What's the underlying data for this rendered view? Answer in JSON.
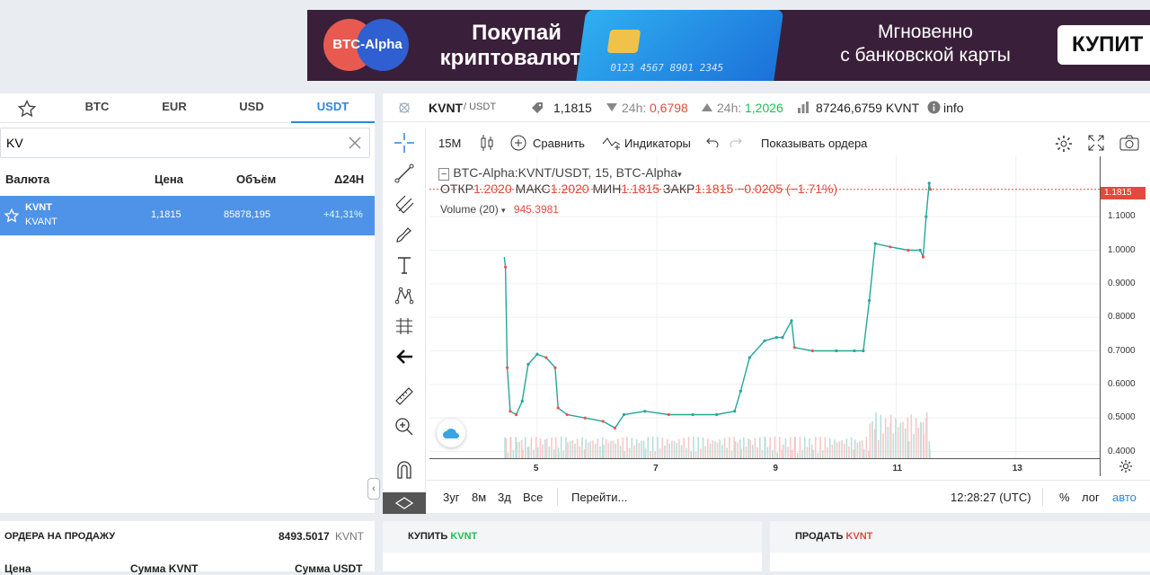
{
  "banner": {
    "logo_text": "BTC-Alpha",
    "left_line1": "Покупай",
    "left_line2": "криптовалюту",
    "card_number": "0123 4567 8901 2345",
    "right_line1": "Мгновенно",
    "right_line2": "с банковской карты",
    "buy_label": "КУПИТ"
  },
  "market": {
    "favorites_icon": "star-icon",
    "tabs": [
      "BTC",
      "EUR",
      "USD",
      "USDT"
    ],
    "active_tab": "USDT",
    "search": {
      "value": "KV",
      "placeholder": ""
    },
    "columns": [
      "Валюта",
      "Цена",
      "Объём",
      "Δ24H"
    ],
    "rows": [
      {
        "symbol": "KVNT",
        "name": "KVANT",
        "price": "1,1815",
        "volume": "85878,195",
        "change": "+41,31%"
      }
    ]
  },
  "ticker": {
    "symbol": "KVNT",
    "quote": "/ USDT",
    "last_price": "1,1815",
    "low_label": "24h:",
    "low_value": "0,6798",
    "high_label": "24h:",
    "high_value": "1,2026",
    "volume": "87246,6759 KVNT",
    "info_label": "info"
  },
  "toolbar": {
    "interval": "15M",
    "compare_label": "Сравнить",
    "indicators_label": "Индикаторы",
    "show_orders_label": "Показывать ордера"
  },
  "chart_legend": {
    "title": "BTC-Alpha:KVNT/USDT, 15, BTC-Alpha",
    "open_label": "ОТКР",
    "open": "1.2020",
    "high_label": "МАКС",
    "high": "1.2020",
    "low_label": "МИН",
    "low": "1.1815",
    "close_label": "ЗАКР",
    "close": "1.1815",
    "change": "−0.0205 (−1.71%)",
    "volume_label": "Volume (20)",
    "volume_value": "945.3981"
  },
  "chart_data": {
    "type": "line",
    "title": "BTC-Alpha:KVNT/USDT, 15, BTC-Alpha",
    "x_ticks": [
      "5",
      "7",
      "9",
      "11",
      "13"
    ],
    "y_ticks": [
      "1.1000",
      "1.0000",
      "0.9000",
      "0.8000",
      "0.7000",
      "0.6000",
      "0.5000",
      "0.4000"
    ],
    "ylim": [
      0.38,
      1.28
    ],
    "xlim": [
      3.2,
      14.4
    ],
    "current_price": "1.1815",
    "series": [
      {
        "values": [
          [
            4.45,
            0.98
          ],
          [
            4.47,
            0.95
          ],
          [
            4.5,
            0.65
          ],
          [
            4.55,
            0.52
          ],
          [
            4.65,
            0.51
          ],
          [
            4.75,
            0.55
          ],
          [
            4.85,
            0.66
          ],
          [
            5.0,
            0.69
          ],
          [
            5.15,
            0.68
          ],
          [
            5.3,
            0.65
          ],
          [
            5.35,
            0.53
          ],
          [
            5.5,
            0.51
          ],
          [
            5.8,
            0.5
          ],
          [
            6.1,
            0.49
          ],
          [
            6.3,
            0.47
          ],
          [
            6.45,
            0.51
          ],
          [
            6.8,
            0.52
          ],
          [
            7.2,
            0.51
          ],
          [
            7.6,
            0.51
          ],
          [
            8.0,
            0.51
          ],
          [
            8.3,
            0.52
          ],
          [
            8.4,
            0.58
          ],
          [
            8.55,
            0.68
          ],
          [
            8.8,
            0.73
          ],
          [
            9.0,
            0.74
          ],
          [
            9.1,
            0.74
          ],
          [
            9.25,
            0.79
          ],
          [
            9.3,
            0.71
          ],
          [
            9.6,
            0.7
          ],
          [
            10.0,
            0.7
          ],
          [
            10.3,
            0.7
          ],
          [
            10.45,
            0.7
          ],
          [
            10.55,
            0.85
          ],
          [
            10.65,
            1.02
          ],
          [
            10.9,
            1.01
          ],
          [
            11.2,
            1.0
          ],
          [
            11.4,
            1.0
          ],
          [
            11.45,
            0.98
          ],
          [
            11.5,
            1.1
          ],
          [
            11.55,
            1.2
          ],
          [
            11.57,
            1.1815
          ]
        ]
      }
    ],
    "grid": true
  },
  "bottom_bar": {
    "ranges": [
      "3уг",
      "8м",
      "3д",
      "Все"
    ],
    "goto_label": "Перейти...",
    "time": "12:28:27 (UTC)",
    "percent_label": "%",
    "log_label": "лог",
    "auto_label": "авто"
  },
  "sell_orders": {
    "title": "ОРДЕРА НА ПРОДАЖУ",
    "total": "8493.5017",
    "total_unit": "KVNT",
    "col_price": "Цена",
    "col_amount": "Сумма KVNT",
    "col_total": "Сумма USDT"
  },
  "buy_panel": {
    "label": "КУПИТЬ",
    "asset": "KVNT"
  },
  "sell_panel": {
    "label": "ПРОДАТЬ",
    "asset": "KVNT"
  },
  "colors": {
    "accent": "#2f86e0",
    "up": "#26a69a",
    "down": "#ef5350",
    "selected_row": "#4f93e8"
  }
}
